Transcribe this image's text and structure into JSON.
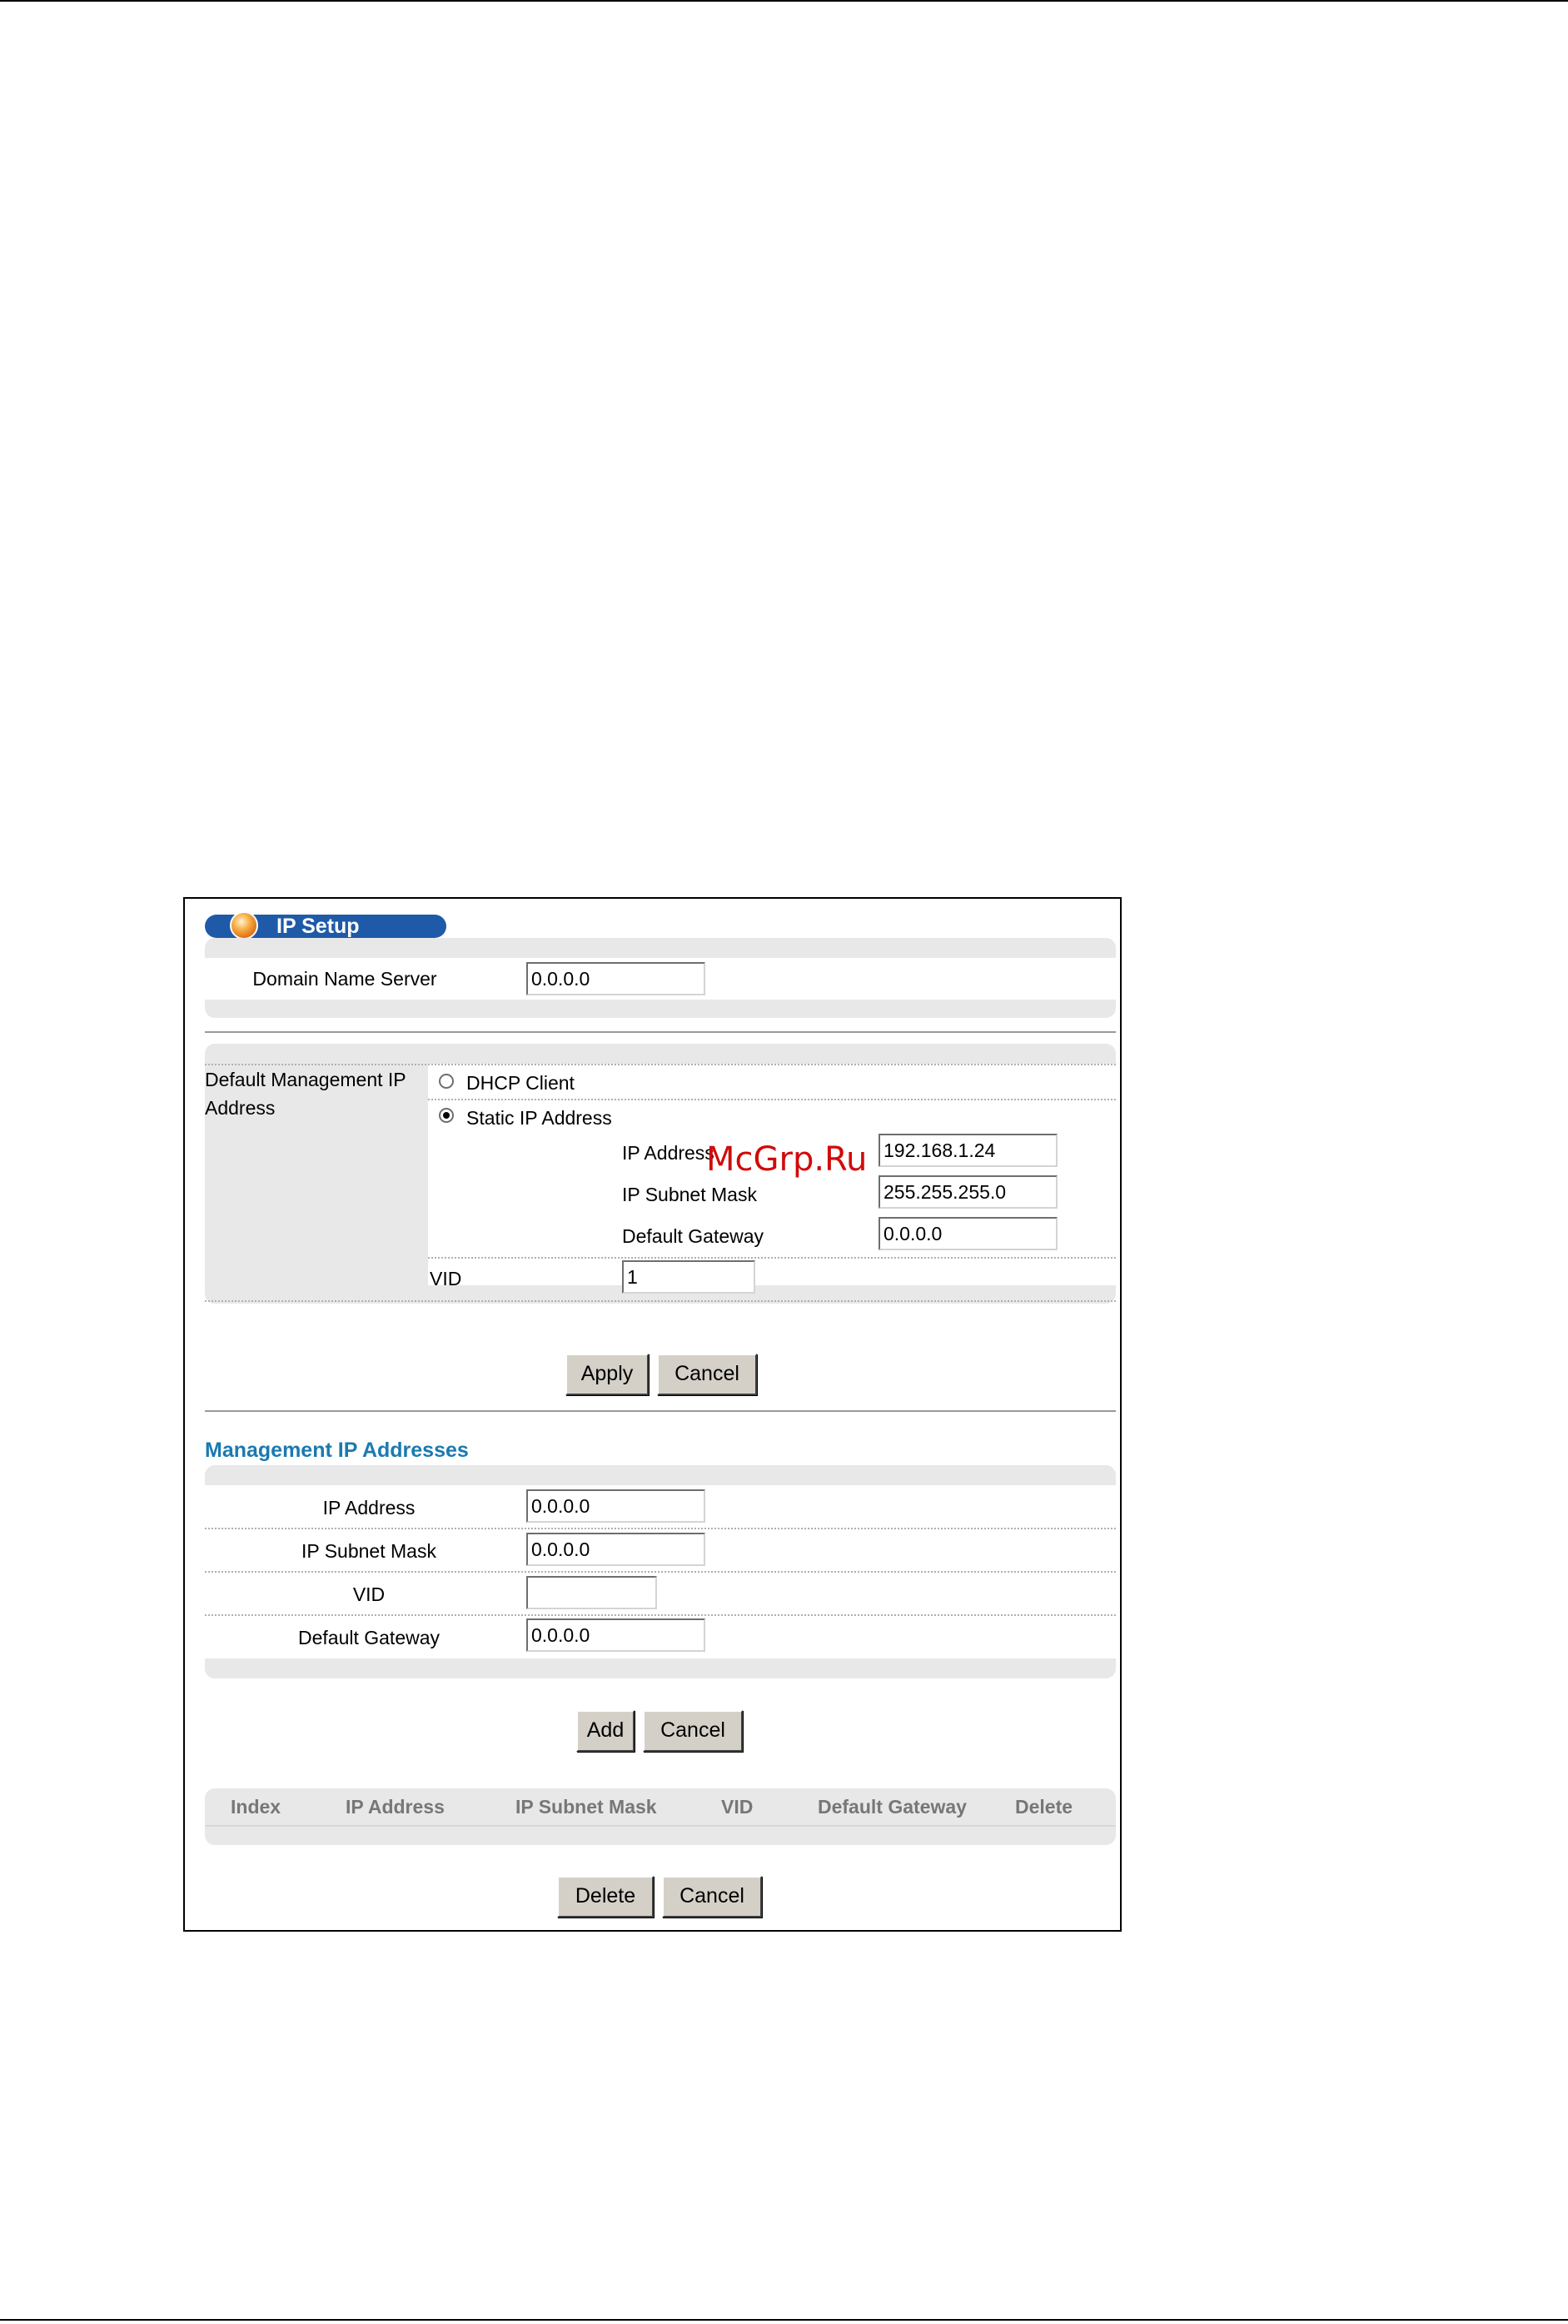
{
  "title": "IP Setup",
  "dns": {
    "label": "Domain Name Server",
    "value": "0.0.0.0"
  },
  "default_mgmt": {
    "label_line1": "Default Management IP",
    "label_line2": "Address",
    "dhcp_label": "DHCP Client",
    "static_label": "Static IP Address",
    "selected": "static",
    "ip_label": "IP Address",
    "ip_value": "192.168.1.24",
    "mask_label": "IP Subnet Mask",
    "mask_value": "255.255.255.0",
    "gw_label": "Default Gateway",
    "gw_value": "0.0.0.0",
    "vid_label": "VID",
    "vid_value": "1"
  },
  "buttons1": {
    "apply": "Apply",
    "cancel": "Cancel"
  },
  "mgmt": {
    "heading": "Management IP Addresses",
    "ip_label": "IP Address",
    "ip_value": "0.0.0.0",
    "mask_label": "IP Subnet Mask",
    "mask_value": "0.0.0.0",
    "vid_label": "VID",
    "vid_value": "",
    "gw_label": "Default Gateway",
    "gw_value": "0.0.0.0"
  },
  "buttons2": {
    "add": "Add",
    "cancel": "Cancel"
  },
  "table": {
    "headers": [
      "Index",
      "IP Address",
      "IP Subnet Mask",
      "VID",
      "Default Gateway",
      "Delete"
    ]
  },
  "buttons3": {
    "delete": "Delete",
    "cancel": "Cancel"
  },
  "watermark": "McGrp.Ru"
}
